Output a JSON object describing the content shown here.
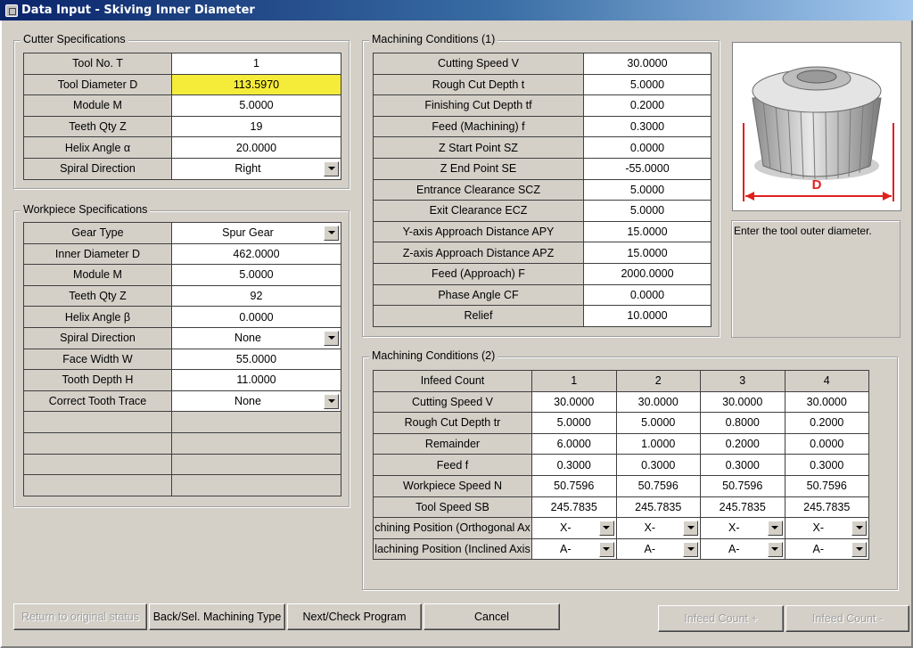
{
  "window": {
    "title": "Data Input - Skiving Inner Diameter"
  },
  "cutter": {
    "title": "Cutter Specifications",
    "rows": [
      {
        "label": "Tool No. T",
        "value": "1"
      },
      {
        "label": "Tool Diameter D",
        "value": "113.5970"
      },
      {
        "label": "Module M",
        "value": "5.0000"
      },
      {
        "label": "Teeth Qty Z",
        "value": "19"
      },
      {
        "label": "Helix Angle α",
        "value": "20.0000"
      },
      {
        "label": "Spiral Direction",
        "value": "Right"
      }
    ]
  },
  "workpiece": {
    "title": "Workpiece Specifications",
    "rows": [
      {
        "label": "Gear Type",
        "value": "Spur Gear"
      },
      {
        "label": "Inner Diameter D",
        "value": "462.0000"
      },
      {
        "label": "Module M",
        "value": "5.0000"
      },
      {
        "label": "Teeth Qty Z",
        "value": "92"
      },
      {
        "label": "Helix Angle β",
        "value": "0.0000"
      },
      {
        "label": "Spiral Direction",
        "value": "None"
      },
      {
        "label": "Face Width W",
        "value": "55.0000"
      },
      {
        "label": "Tooth Depth H",
        "value": "11.0000"
      },
      {
        "label": "Correct Tooth Trace",
        "value": "None"
      }
    ]
  },
  "mc1": {
    "title": "Machining Conditions (1)",
    "rows": [
      {
        "label": "Cutting Speed V",
        "value": "30.0000"
      },
      {
        "label": "Rough Cut Depth t",
        "value": "5.0000"
      },
      {
        "label": "Finishing Cut Depth tf",
        "value": "0.2000"
      },
      {
        "label": "Feed (Machining) f",
        "value": "0.3000"
      },
      {
        "label": "Z Start Point SZ",
        "value": "0.0000"
      },
      {
        "label": "Z End Point SE",
        "value": "-55.0000"
      },
      {
        "label": "Entrance Clearance SCZ",
        "value": "5.0000"
      },
      {
        "label": "Exit Clearance ECZ",
        "value": "5.0000"
      },
      {
        "label": "Y-axis Approach Distance APY",
        "value": "15.0000"
      },
      {
        "label": "Z-axis Approach Distance APZ",
        "value": "15.0000"
      },
      {
        "label": "Feed (Approach) F",
        "value": "2000.0000"
      },
      {
        "label": "Phase Angle CF",
        "value": "0.0000"
      },
      {
        "label": "Relief",
        "value": "10.0000"
      }
    ]
  },
  "mc2": {
    "title": "Machining Conditions (2)",
    "header": {
      "label": "Infeed Count",
      "cols": [
        "1",
        "2",
        "3",
        "4"
      ]
    },
    "rows": [
      {
        "label": "Cutting Speed V",
        "values": [
          "30.0000",
          "30.0000",
          "30.0000",
          "30.0000"
        ]
      },
      {
        "label": "Rough Cut Depth tr",
        "values": [
          "5.0000",
          "5.0000",
          "0.8000",
          "0.2000"
        ]
      },
      {
        "label": "Remainder",
        "values": [
          "6.0000",
          "1.0000",
          "0.2000",
          "0.0000"
        ]
      },
      {
        "label": "Feed f",
        "values": [
          "0.3000",
          "0.3000",
          "0.3000",
          "0.3000"
        ]
      },
      {
        "label": "Workpiece Speed N",
        "values": [
          "50.7596",
          "50.7596",
          "50.7596",
          "50.7596"
        ]
      },
      {
        "label": "Tool Speed SB",
        "values": [
          "245.7835",
          "245.7835",
          "245.7835",
          "245.7835"
        ]
      },
      {
        "label": "chining Position (Orthogonal Ax",
        "values": [
          "X-",
          "X-",
          "X-",
          "X-"
        ]
      },
      {
        "label": "lachining Position (Inclined Axis",
        "values": [
          "A-",
          "A-",
          "A-",
          "A-"
        ]
      }
    ]
  },
  "image_label": "D",
  "hint": "Enter the tool outer diameter.",
  "buttons": {
    "return": "Return to original status",
    "back": "Back/Sel. Machining Type",
    "next": "Next/Check Program",
    "cancel": "Cancel",
    "infeed_plus": "Infeed Count +",
    "infeed_minus": "Infeed Count -"
  },
  "colors": {
    "highlight": "#f5ec3a",
    "dimension_line": "#e02020"
  }
}
